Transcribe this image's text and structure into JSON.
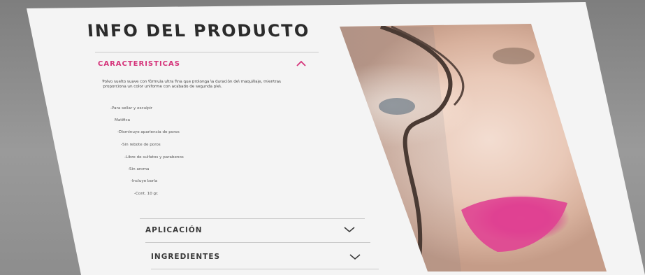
{
  "page": {
    "title": "INFO DEL PRODUCTO"
  },
  "sections": {
    "characteristics": {
      "label": "CARACTERISTICAS",
      "expanded": true,
      "description": "Polvo suelto suave con fórmula ultra fina que prolonga la duración del maquillaje, mientras proporciona un color uniforme con acabado de segunda piel.",
      "features": [
        "-Para sellar y esculpir",
        "Matifica",
        "-Disminuye apariencia de poros",
        "-Sin rebote de poros",
        "-Libre de sulfatos y parabenos",
        "-Sin aroma",
        "-Incluye borla",
        "-Cont. 10 gr."
      ]
    },
    "application": {
      "label": "APLICACIÓN",
      "expanded": false
    },
    "ingredients": {
      "label": "INGREDIENTES",
      "expanded": false
    }
  },
  "colors": {
    "accent": "#d5337a",
    "text": "#2b2b2b",
    "background": "#8c8c8c",
    "sheet": "#f4f4f4"
  },
  "icons": {
    "collapse": "chevron-up-icon",
    "expand": "chevron-down-icon"
  }
}
